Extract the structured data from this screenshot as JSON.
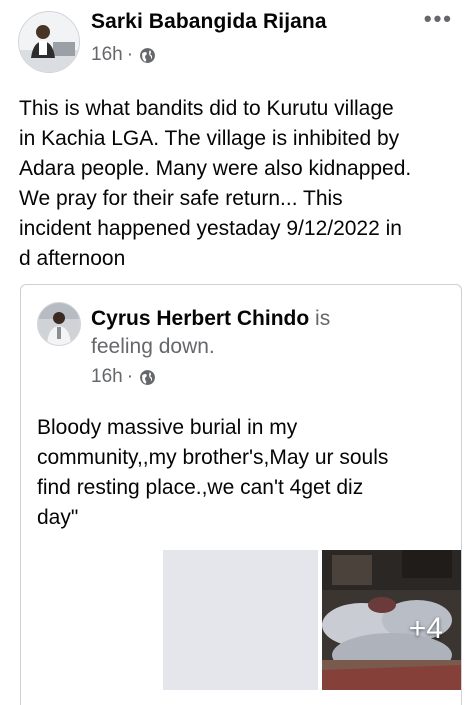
{
  "post": {
    "author": "Sarki Babangida Rijana",
    "time": "16h",
    "dot": "·",
    "more": "•••",
    "text": "This is what bandits did to Kurutu village\nin  Kachia LGA. The village is inhibited by\nAdara people. Many were also kidnapped.\nWe pray for their safe return... This\nincident happened yestaday 9/12/2022 in\nd afternoon"
  },
  "shared": {
    "author": "Cyrus Herbert Chindo",
    "feeling": "is feeling down.",
    "time": "16h",
    "dot": "·",
    "text": "Bloody massive burial in my\ncommunity,,my brother's,May ur souls\nfind resting place.,we can't 4get diz\nday\"",
    "more_photos": "+4"
  },
  "icons": {
    "privacy": "globe-icon",
    "menu": "more-options-icon"
  },
  "colors": {
    "secondary_text": "#65676b",
    "border": "#ced0d4",
    "placeholder": "#e4e6eb"
  }
}
